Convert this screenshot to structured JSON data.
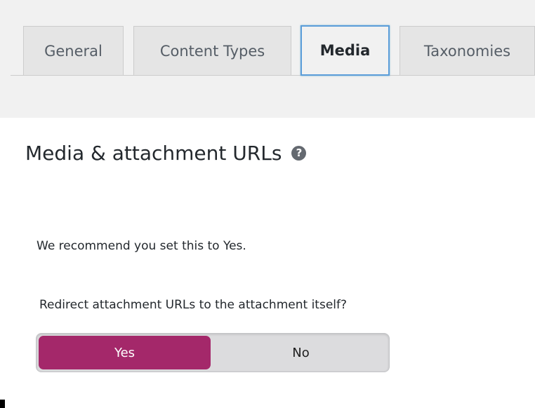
{
  "tabs": [
    {
      "label": "General",
      "active": false
    },
    {
      "label": "Content Types",
      "active": false
    },
    {
      "label": "Media",
      "active": true
    },
    {
      "label": "Taxonomies",
      "active": false
    }
  ],
  "section": {
    "title": "Media & attachment URLs",
    "help_icon": "question-mark-icon",
    "help_glyph": "?"
  },
  "recommendation": "We recommend you set this to Yes.",
  "setting": {
    "question": "Redirect attachment URLs to the attachment itself?",
    "options": [
      {
        "label": "Yes",
        "selected": true
      },
      {
        "label": "No",
        "selected": false
      }
    ]
  },
  "colors": {
    "accent": "#a4286a",
    "tab_focus_border": "#5b9dd9",
    "background": "#f1f1f1"
  }
}
